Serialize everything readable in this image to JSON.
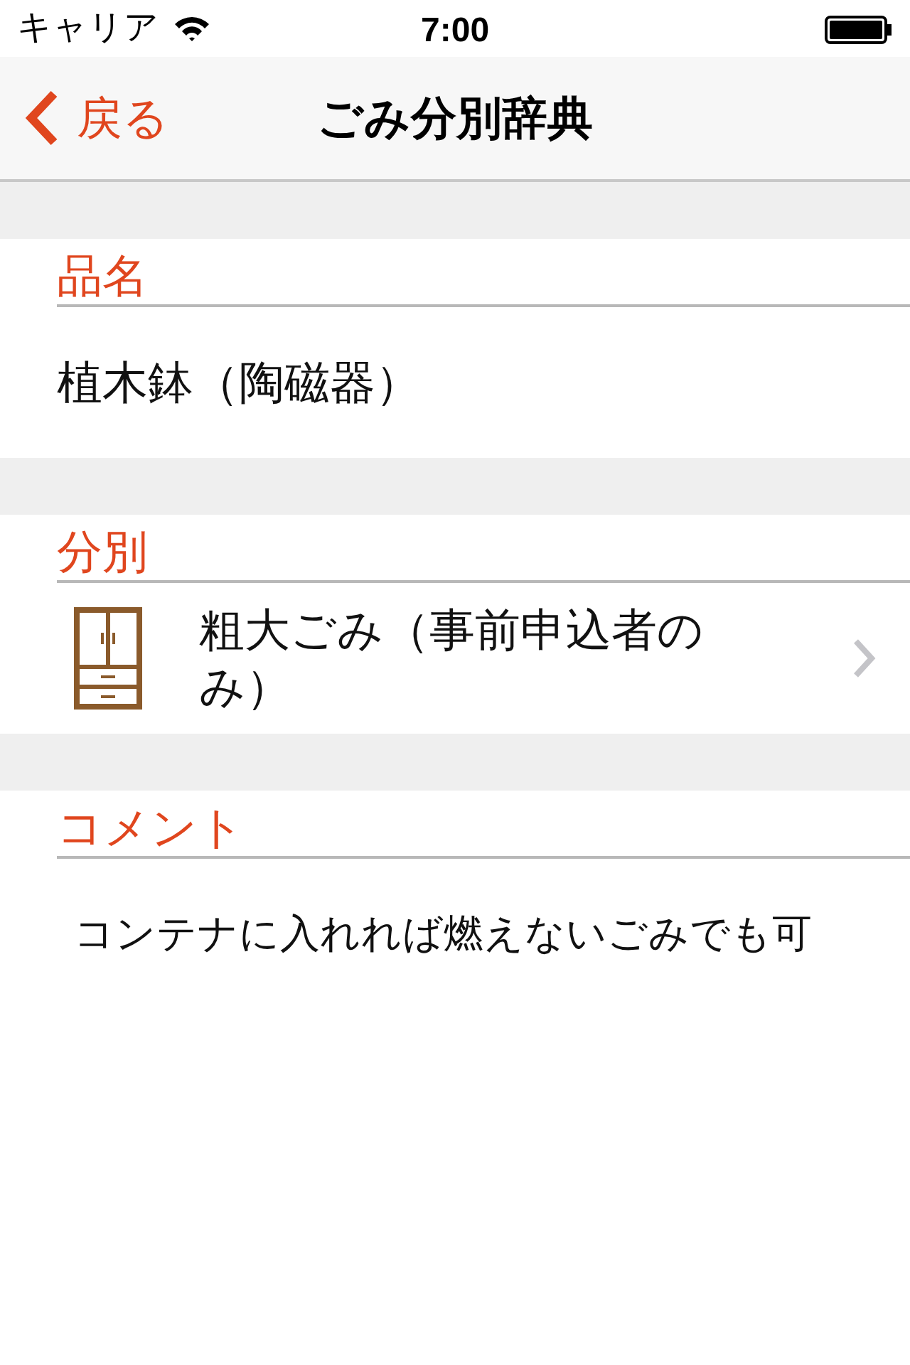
{
  "status_bar": {
    "carrier": "キャリア",
    "time": "7:00"
  },
  "nav": {
    "back_label": "戻る",
    "title": "ごみ分別辞典"
  },
  "sections": [
    {
      "header": "品名",
      "kind": "text",
      "text": "植木鉢（陶磁器）"
    },
    {
      "header": "分別",
      "kind": "link",
      "text": "粗大ごみ（事前申込者のみ）"
    },
    {
      "header": "コメント",
      "kind": "comment",
      "text": "コンテナに入れれば燃えないごみでも可"
    }
  ]
}
